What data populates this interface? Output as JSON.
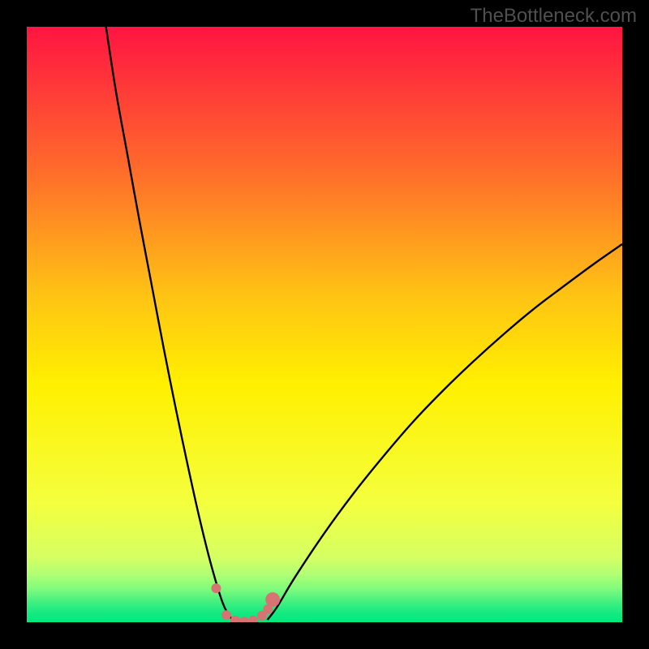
{
  "watermark": "TheBottleneck.com",
  "colors": {
    "black": "#000000",
    "curve": "#000000",
    "marker": "#d87373",
    "green_bottom": "#00e97f",
    "yellow_mid": "#fff000",
    "red_top": "#ff1442"
  },
  "chart_data": {
    "type": "line",
    "title": "",
    "xlabel": "",
    "ylabel": "",
    "xlim": [
      0,
      100
    ],
    "ylim": [
      0,
      100
    ],
    "grid": false,
    "series": [
      {
        "name": "bottleneck-curve-left",
        "x": [
          13.3,
          15,
          17,
          19,
          21,
          23,
          25,
          27,
          29,
          31,
          33,
          34.5
        ],
        "y": [
          100,
          89,
          78,
          67,
          56.5,
          46,
          36,
          26.5,
          17.5,
          9.5,
          3,
          0.4
        ]
      },
      {
        "name": "bottleneck-curve-right",
        "x": [
          40.4,
          42,
          45,
          50,
          55,
          60,
          65,
          70,
          75,
          80,
          85,
          90,
          95,
          100
        ],
        "y": [
          0.4,
          2.5,
          7.5,
          15,
          21.8,
          28,
          33.8,
          39,
          43.8,
          48.3,
          52.5,
          56.3,
          60,
          63.5
        ]
      }
    ],
    "markers": {
      "name": "sweet-spot",
      "points": [
        {
          "x": 31.8,
          "y": 5.7
        },
        {
          "x": 33.5,
          "y": 1.2
        },
        {
          "x": 35.0,
          "y": 0.3
        },
        {
          "x": 36.5,
          "y": 0.1
        },
        {
          "x": 38.0,
          "y": 0.3
        },
        {
          "x": 39.5,
          "y": 1.1
        },
        {
          "x": 40.5,
          "y": 2.2
        },
        {
          "x": 41.3,
          "y": 3.8
        }
      ],
      "radius_large_indices": [
        7
      ],
      "radius_small": 6,
      "radius_large": 9
    },
    "gradient_stops": [
      {
        "offset": 0.0,
        "color": "#ff1442"
      },
      {
        "offset": 0.25,
        "color": "#ff6f2a"
      },
      {
        "offset": 0.45,
        "color": "#ffc314"
      },
      {
        "offset": 0.6,
        "color": "#fff000"
      },
      {
        "offset": 0.8,
        "color": "#f4ff3e"
      },
      {
        "offset": 0.89,
        "color": "#d6ff62"
      },
      {
        "offset": 0.92,
        "color": "#b0ff74"
      },
      {
        "offset": 0.945,
        "color": "#7dfb7c"
      },
      {
        "offset": 0.965,
        "color": "#45f080"
      },
      {
        "offset": 0.985,
        "color": "#12ea80"
      },
      {
        "offset": 1.0,
        "color": "#00e97f"
      }
    ]
  }
}
